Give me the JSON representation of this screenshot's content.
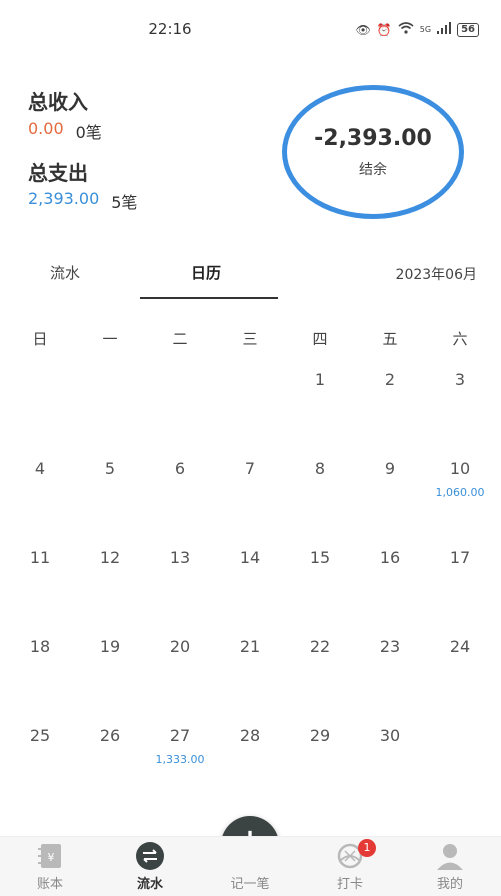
{
  "status": {
    "time": "22:16",
    "network": "5G",
    "battery": "56"
  },
  "summary": {
    "income_label": "总收入",
    "income_amount": "0.00",
    "income_count": "0笔",
    "expense_label": "总支出",
    "expense_amount": "2,393.00",
    "expense_count": "5笔",
    "balance_amount": "-2,393.00",
    "balance_label": "结余"
  },
  "tabs": [
    {
      "label": "流水"
    },
    {
      "label": "日历"
    }
  ],
  "month": "2023年06月",
  "calendar": {
    "weekdays": [
      "日",
      "一",
      "二",
      "三",
      "四",
      "五",
      "六"
    ],
    "weeks": [
      [
        {
          "d": ""
        },
        {
          "d": ""
        },
        {
          "d": ""
        },
        {
          "d": ""
        },
        {
          "d": "1"
        },
        {
          "d": "2"
        },
        {
          "d": "3"
        }
      ],
      [
        {
          "d": "4"
        },
        {
          "d": "5"
        },
        {
          "d": "6"
        },
        {
          "d": "7"
        },
        {
          "d": "8"
        },
        {
          "d": "9"
        },
        {
          "d": "10",
          "amt": "1,060.00"
        }
      ],
      [
        {
          "d": "11"
        },
        {
          "d": "12"
        },
        {
          "d": "13"
        },
        {
          "d": "14"
        },
        {
          "d": "15"
        },
        {
          "d": "16"
        },
        {
          "d": "17"
        }
      ],
      [
        {
          "d": "18"
        },
        {
          "d": "19"
        },
        {
          "d": "20"
        },
        {
          "d": "21"
        },
        {
          "d": "22"
        },
        {
          "d": "23"
        },
        {
          "d": "24"
        }
      ],
      [
        {
          "d": "25"
        },
        {
          "d": "26"
        },
        {
          "d": "27",
          "amt": "1,333.00"
        },
        {
          "d": "28"
        },
        {
          "d": "29"
        },
        {
          "d": "30"
        },
        {
          "d": ""
        }
      ]
    ]
  },
  "nav": [
    {
      "label": "账本",
      "icon": "ledger-icon"
    },
    {
      "label": "流水",
      "icon": "transfer-icon"
    },
    {
      "label": "记一笔",
      "icon": "plus-icon"
    },
    {
      "label": "打卡",
      "icon": "checkin-icon",
      "badge": "1"
    },
    {
      "label": "我的",
      "icon": "profile-icon"
    }
  ],
  "colors": {
    "accent": "#3c8ee0",
    "income": "#e36a3e",
    "expense": "#3a8fd8",
    "fab": "#3b4343",
    "badge": "#e53935"
  }
}
